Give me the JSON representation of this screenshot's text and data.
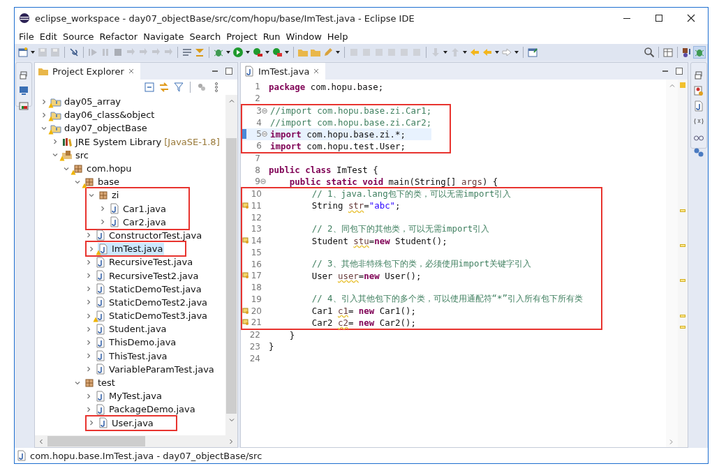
{
  "window": {
    "title": "eclipse_workspace - day07_objectBase/src/com/hopu/base/ImTest.java - Eclipse IDE"
  },
  "menu": [
    "File",
    "Edit",
    "Source",
    "Refactor",
    "Navigate",
    "Search",
    "Project",
    "Run",
    "Window",
    "Help"
  ],
  "explorer": {
    "title": "Project Explorer",
    "tree": [
      {
        "label": "day05_array",
        "kind": "project",
        "expanded": false,
        "selected": false,
        "warning": true,
        "marked": false
      },
      {
        "label": "day06_class&object",
        "kind": "project",
        "expanded": false,
        "selected": false,
        "warning": true,
        "marked": false
      },
      {
        "label": "day07_objectBase",
        "kind": "project",
        "expanded": true,
        "selected": false,
        "warning": true,
        "marked": false,
        "children": [
          {
            "label": "JRE System Library",
            "note": "[JavaSE-1.8]",
            "kind": "library",
            "expanded": false,
            "selected": false,
            "warning": false,
            "marked": false
          },
          {
            "label": "src",
            "kind": "source",
            "expanded": true,
            "selected": false,
            "warning": true,
            "marked": false,
            "children": [
              {
                "label": "com.hopu",
                "kind": "package",
                "expanded": true,
                "selected": false,
                "warning": true,
                "marked": false,
                "children": [
                  {
                    "label": "base",
                    "kind": "package",
                    "expanded": true,
                    "selected": false,
                    "warning": true,
                    "marked": false,
                    "children": [
                      {
                        "label": "zi",
                        "kind": "package",
                        "expanded": true,
                        "selected": false,
                        "warning": false,
                        "marked": true,
                        "children": [
                          {
                            "label": "Car1.java",
                            "kind": "java",
                            "expanded": false,
                            "selected": false,
                            "warning": false,
                            "marked": false
                          },
                          {
                            "label": "Car2.java",
                            "kind": "java",
                            "expanded": false,
                            "selected": false,
                            "warning": false,
                            "marked": false
                          }
                        ]
                      },
                      {
                        "label": "ConstructorTest.java",
                        "kind": "java",
                        "expanded": false,
                        "selected": false,
                        "warning": false,
                        "marked": false
                      },
                      {
                        "label": "ImTest.java",
                        "kind": "java",
                        "expanded": false,
                        "selected": true,
                        "warning": true,
                        "marked": true
                      },
                      {
                        "label": "RecursiveTest.java",
                        "kind": "java",
                        "expanded": false,
                        "selected": false,
                        "warning": false,
                        "marked": false
                      },
                      {
                        "label": "RecursiveTest2.java",
                        "kind": "java",
                        "expanded": false,
                        "selected": false,
                        "warning": false,
                        "marked": false
                      },
                      {
                        "label": "StaticDemoTest.java",
                        "kind": "java",
                        "expanded": false,
                        "selected": false,
                        "warning": false,
                        "marked": false
                      },
                      {
                        "label": "StaticDemoTest2.java",
                        "kind": "java",
                        "expanded": false,
                        "selected": false,
                        "warning": false,
                        "marked": false
                      },
                      {
                        "label": "StaticDemoTest3.java",
                        "kind": "java",
                        "expanded": false,
                        "selected": false,
                        "warning": true,
                        "marked": false
                      },
                      {
                        "label": "Student.java",
                        "kind": "java",
                        "expanded": false,
                        "selected": false,
                        "warning": false,
                        "marked": false
                      },
                      {
                        "label": "ThisDemo.java",
                        "kind": "java",
                        "expanded": false,
                        "selected": false,
                        "warning": false,
                        "marked": false
                      },
                      {
                        "label": "ThisTest.java",
                        "kind": "java",
                        "expanded": false,
                        "selected": false,
                        "warning": false,
                        "marked": false
                      },
                      {
                        "label": "VariableParamTest.java",
                        "kind": "java",
                        "expanded": false,
                        "selected": false,
                        "warning": false,
                        "marked": false
                      }
                    ]
                  },
                  {
                    "label": "test",
                    "kind": "package",
                    "expanded": true,
                    "selected": false,
                    "warning": false,
                    "marked": false,
                    "children": [
                      {
                        "label": "MyTest.java",
                        "kind": "java",
                        "expanded": false,
                        "selected": false,
                        "warning": false,
                        "marked": false
                      },
                      {
                        "label": "PackageDemo.java",
                        "kind": "java",
                        "expanded": false,
                        "selected": false,
                        "warning": false,
                        "marked": false
                      },
                      {
                        "label": "User.java",
                        "kind": "java",
                        "expanded": false,
                        "selected": false,
                        "warning": false,
                        "marked": true
                      }
                    ]
                  }
                ]
              }
            ]
          }
        ]
      }
    ]
  },
  "editor": {
    "tab": "ImTest.java",
    "blocks": [
      {
        "marked": false,
        "lines": [
          {
            "number": "1",
            "fold": false,
            "warning": false,
            "current": false,
            "tokens": [
              {
                "kind": "kw",
                "text": "package"
              },
              {
                "kind": "txt",
                "text": " com.hopu.base;"
              }
            ]
          },
          {
            "number": "2",
            "fold": false,
            "warning": false,
            "current": false
          }
        ]
      },
      {
        "marked": true,
        "lines": [
          {
            "number": "3",
            "fold": true,
            "warning": false,
            "current": false,
            "tokens": [
              {
                "kind": "cm",
                "text": "//import com.hopu.base.zi.Car1;"
              }
            ]
          },
          {
            "number": "4",
            "fold": false,
            "warning": false,
            "current": false,
            "tokens": [
              {
                "kind": "cm",
                "text": "//import com.hopu.base.zi.Car2;"
              }
            ]
          },
          {
            "number": "5",
            "fold": true,
            "warning": false,
            "current": true,
            "tokens": [
              {
                "kind": "kw",
                "text": "import"
              },
              {
                "kind": "txt",
                "text": " com.hopu.base.zi.*;"
              }
            ]
          },
          {
            "number": "6",
            "fold": false,
            "warning": false,
            "current": false,
            "tokens": [
              {
                "kind": "kw",
                "text": "import"
              },
              {
                "kind": "txt",
                "text": " com.hopu.test.User;"
              }
            ]
          }
        ]
      },
      {
        "marked": false,
        "lines": [
          {
            "number": "7",
            "fold": false,
            "warning": false,
            "current": false
          },
          {
            "number": "8",
            "fold": false,
            "warning": false,
            "current": false,
            "tokens": [
              {
                "kind": "kw",
                "text": "public class"
              },
              {
                "kind": "txt",
                "text": " ImTest {"
              }
            ]
          },
          {
            "number": "9",
            "fold": true,
            "warning": false,
            "current": false,
            "tokens": [
              {
                "kind": "kw",
                "text": "    public static void"
              },
              {
                "kind": "txt",
                "text": " main(String[] "
              },
              {
                "kind": "var",
                "text": "args"
              },
              {
                "kind": "txt",
                "text": ") {"
              }
            ]
          }
        ]
      },
      {
        "marked": true,
        "lines": [
          {
            "number": "10",
            "fold": false,
            "warning": false,
            "current": false,
            "tokens": [
              {
                "kind": "cm",
                "text": "        // 1、java.lang包下的类，可以无需import引入"
              }
            ]
          },
          {
            "number": "11",
            "fold": false,
            "warning": true,
            "current": false,
            "tokens": [
              {
                "kind": "txt",
                "text": "        String "
              },
              {
                "kind": "warn",
                "text": "str"
              },
              {
                "kind": "txt",
                "text": "="
              },
              {
                "kind": "str",
                "text": "\"abc\""
              },
              {
                "kind": "txt",
                "text": ";"
              }
            ]
          },
          {
            "number": "12",
            "fold": false,
            "warning": false,
            "current": false
          },
          {
            "number": "13",
            "fold": false,
            "warning": false,
            "current": false,
            "tokens": [
              {
                "kind": "cm",
                "text": "        // 2、同包下的其他类，可以无需import引入"
              }
            ]
          },
          {
            "number": "14",
            "fold": false,
            "warning": true,
            "current": false,
            "tokens": [
              {
                "kind": "txt",
                "text": "        Student "
              },
              {
                "kind": "warn",
                "text": "stu"
              },
              {
                "kind": "txt",
                "text": "="
              },
              {
                "kind": "kw",
                "text": "new"
              },
              {
                "kind": "txt",
                "text": " Student();"
              }
            ]
          },
          {
            "number": "15",
            "fold": false,
            "warning": false,
            "current": false
          },
          {
            "number": "16",
            "fold": false,
            "warning": false,
            "current": false,
            "tokens": [
              {
                "kind": "cm",
                "text": "        // 3、其他非特殊包下的类，必须使用import关键字引入"
              }
            ]
          },
          {
            "number": "17",
            "fold": false,
            "warning": true,
            "current": false,
            "tokens": [
              {
                "kind": "txt",
                "text": "        User "
              },
              {
                "kind": "warn",
                "text": "user"
              },
              {
                "kind": "txt",
                "text": "="
              },
              {
                "kind": "kw",
                "text": "new"
              },
              {
                "kind": "txt",
                "text": " User();"
              }
            ]
          },
          {
            "number": "18",
            "fold": false,
            "warning": false,
            "current": false
          },
          {
            "number": "19",
            "fold": false,
            "warning": false,
            "current": false,
            "tokens": [
              {
                "kind": "cm",
                "text": "        // 4、引入其他包下的多个类，可以使用通配符“*”引入所有包下所有类"
              }
            ]
          },
          {
            "number": "20",
            "fold": false,
            "warning": true,
            "current": false,
            "tokens": [
              {
                "kind": "txt",
                "text": "        Car1 "
              },
              {
                "kind": "warn",
                "text": "c1"
              },
              {
                "kind": "txt",
                "text": "= "
              },
              {
                "kind": "kw",
                "text": "new"
              },
              {
                "kind": "txt",
                "text": " Car1();"
              }
            ]
          },
          {
            "number": "21",
            "fold": false,
            "warning": true,
            "current": false,
            "tokens": [
              {
                "kind": "txt",
                "text": "        Car2 "
              },
              {
                "kind": "warn",
                "text": "c2"
              },
              {
                "kind": "txt",
                "text": "= "
              },
              {
                "kind": "kw",
                "text": "new"
              },
              {
                "kind": "txt",
                "text": " Car2();"
              }
            ]
          }
        ]
      },
      {
        "marked": false,
        "lines": [
          {
            "number": "22",
            "fold": false,
            "warning": false,
            "current": false,
            "tokens": [
              {
                "kind": "txt",
                "text": "    }"
              }
            ]
          },
          {
            "number": "23",
            "fold": false,
            "warning": false,
            "current": false,
            "tokens": [
              {
                "kind": "txt",
                "text": "}"
              }
            ]
          },
          {
            "number": "24",
            "fold": false,
            "warning": false,
            "current": false
          }
        ]
      }
    ]
  },
  "status_bar": {
    "text": "com.hopu.base.ImTest.java - day07_objectBase/src"
  }
}
